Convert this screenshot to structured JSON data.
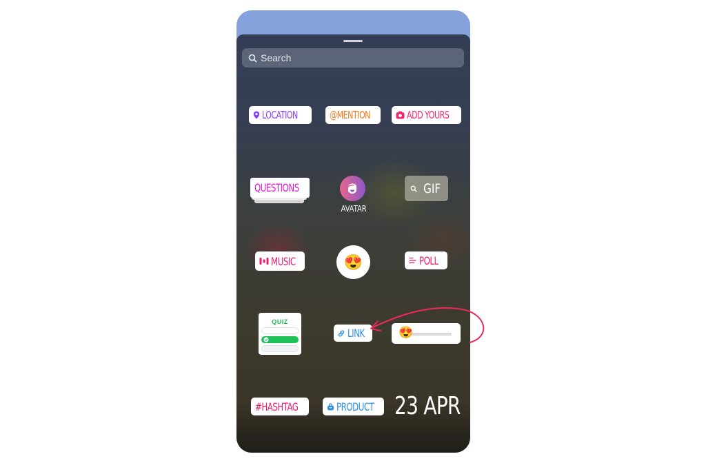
{
  "search": {
    "placeholder": "Search",
    "icon": "search-icon"
  },
  "stickers": {
    "location": {
      "label": "LOCATION",
      "icon": "location-pin-icon",
      "color": "#8a3ffc"
    },
    "mention": {
      "label": "@MENTION",
      "color": "#f07a1c"
    },
    "add_yours": {
      "label": "ADD YOURS",
      "icon": "camera-icon",
      "color": "#ee2a6f"
    },
    "questions": {
      "label": "QUESTIONS",
      "color": "#e41bd0"
    },
    "avatar": {
      "label": "AVATAR",
      "icon": "avatar-face-icon"
    },
    "gif": {
      "label": "GIF",
      "icon": "search-icon"
    },
    "music": {
      "label": "MUSIC",
      "icon": "music-bars-icon",
      "color": "#ee1c6e"
    },
    "emoji_reaction": {
      "emoji": "😍"
    },
    "poll": {
      "label": "POLL",
      "icon": "poll-lines-icon",
      "color": "#ee1c6e"
    },
    "quiz": {
      "label": "QUIZ",
      "color": "#1fc15a"
    },
    "link": {
      "label": "LINK",
      "icon": "link-icon",
      "color": "#2f8fe6"
    },
    "emoji_slider": {
      "emoji": "😍"
    },
    "hashtag": {
      "label": "#HASHTAG",
      "color": "#ee1c6e"
    },
    "product": {
      "label": "PRODUCT",
      "icon": "shopping-bag-icon",
      "color": "#2f8fe6"
    },
    "date": {
      "label": "23 APR"
    }
  },
  "annotation": {
    "arrow_color": "#ec2a5a"
  }
}
